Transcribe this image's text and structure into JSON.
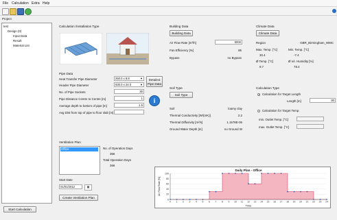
{
  "menu": {
    "file": "File",
    "calculation": "Calculation",
    "extra": "Extra",
    "help": "Help"
  },
  "project": {
    "label": "Project",
    "root": "test",
    "design": "Design (0)",
    "items": [
      "Input Data",
      "Result",
      "Material List"
    ]
  },
  "start_calculation": "Start Calculation",
  "install": {
    "title": "Calculation /Installation Type",
    "pipe_data": "Pipe Data",
    "heat_transfer_label": "Heat Transfer Pipe Diameter",
    "heat_transfer_value": "250.0 x 8.8",
    "header_label": "Header Pipe Diameter",
    "header_value": "630.0 x 24.0",
    "sockets_label": "No. of Pipe Sockets",
    "sockets_value": "30",
    "distance_label": "Pipe Distance Centre to Centre [m]",
    "distance_value": "1",
    "depth_label": "Average depth to bottom of pipe [m]",
    "depth_value": "1.5",
    "avg_dist_label": "Avg Dist from top of pipe to floor slab [m]",
    "avg_dist_value": "",
    "detailed_btn": "Detailed Pipe Data"
  },
  "building": {
    "title": "Building Data",
    "button": "Building Data",
    "air_flow_label": "Air Flow Rate [m³/h]",
    "air_flow_value": "5000",
    "fan_label": "Fan Efficiency [%]",
    "fan_value": "85",
    "bypass_label": "Bypass",
    "bypass_value": "no Bypass"
  },
  "soil": {
    "title": "Soil Type",
    "button": "Soil Type",
    "soil_label": "Soil",
    "soil_value": "loamy clay",
    "cond_label": "Thermal Conductivity [W/(mK)]",
    "cond_value": "2.2",
    "diff_label": "Thermal Diffusivity [m²/s]",
    "diff_value": "1.1578E-06",
    "gw_label": "Ground Water Depth [m]",
    "gw_value": "no Ground W"
  },
  "climate": {
    "title": "Climate Data",
    "button": "Climate Data",
    "region_label": "Region",
    "region_value": "GBR_Birmingham_WMC",
    "max_temp_label": "Max. Temp. [°C]",
    "max_temp_value": "30.4",
    "min_temp_label": "Min. Temp. [°C]",
    "min_temp_value": "-7.4",
    "avg_temp_label": "Ø Temp. [°C]",
    "avg_temp_value": "9.7",
    "humidity_label": "Ø rel. Humidity [%]",
    "humidity_value": "78.4"
  },
  "calctype": {
    "title": "Calculation Type",
    "opt_length": "Calculation for Target Length",
    "length_label": "Length [m]",
    "length_value": "30",
    "opt_temp": "Calculation for Target Temp.",
    "min_outlet_label": "min. Outlet Temp. [°C]",
    "max_outlet_label": "max. Outlet Temp. [°C]"
  },
  "ventilation": {
    "title": "Ventilation Plan",
    "list_item": "Office",
    "op_days_label": "No. of Operation Days",
    "op_days_value": "366",
    "total_days_label": "Total Operation Days",
    "total_days_value": "366",
    "start_label": "Start Date",
    "start_value": "01/01/2012",
    "create_btn": "Create Ventilation Plan"
  },
  "chart_data": {
    "type": "area",
    "title": "Daily Plan - Office",
    "xlabel": "Time",
    "ylabel": "Air Flow Rate [%]",
    "x": [
      0,
      1,
      2,
      3,
      4,
      5,
      6,
      7,
      8,
      9,
      10,
      11,
      12,
      13,
      14,
      15,
      16,
      17,
      18,
      19,
      20,
      21,
      22,
      23,
      24
    ],
    "x_ticks": [
      "0",
      "1",
      "2",
      "3",
      "4",
      "5",
      "6",
      "7",
      "8",
      "9",
      "10",
      "11",
      "12",
      "13",
      "14",
      "15",
      "16",
      "17",
      "18",
      "19",
      "20",
      "21",
      "22",
      "23",
      "24"
    ],
    "y_ticks": [
      "0",
      "20",
      "40",
      "60",
      "80",
      "100"
    ],
    "ylim": [
      0,
      100
    ],
    "series": [
      {
        "values": [
          0,
          0,
          0,
          0,
          0,
          0,
          30,
          30,
          100,
          100,
          100,
          100,
          60,
          60,
          100,
          100,
          100,
          100,
          30,
          30,
          30,
          30,
          0,
          0,
          0
        ]
      }
    ],
    "fill": "#f4b6c0",
    "stroke": "#d94a6a"
  }
}
